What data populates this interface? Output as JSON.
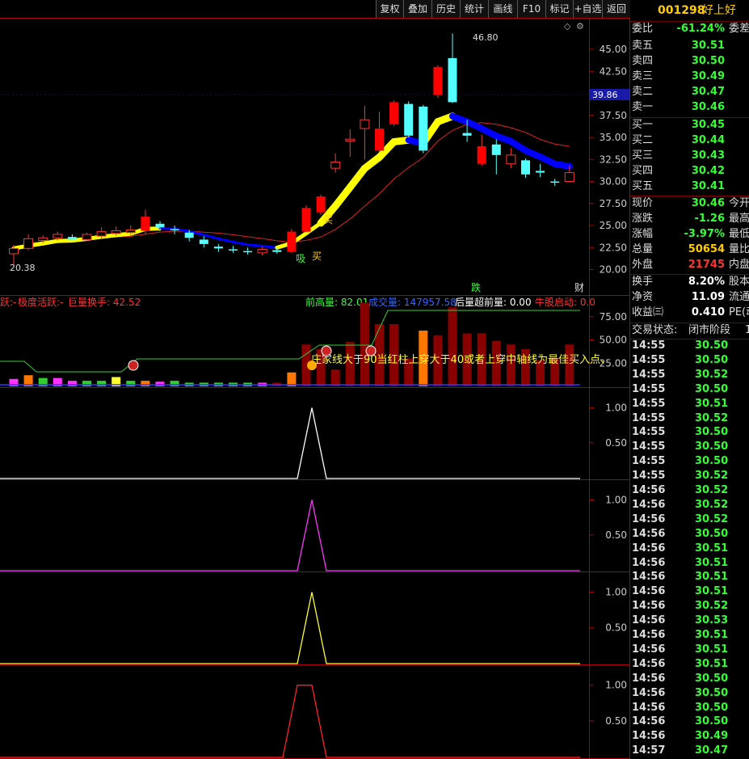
{
  "toolbar": {
    "buttons": [
      "复权",
      "叠加",
      "历史",
      "统计",
      "画线",
      "F10",
      "标记",
      "+自选",
      "返回"
    ]
  },
  "stock": {
    "code": "001298",
    "name": "好上好"
  },
  "quote_ratio": {
    "label": "委比",
    "value": "-61.24%",
    "label2": "委差"
  },
  "asks": [
    {
      "label": "卖五",
      "price": "30.51"
    },
    {
      "label": "卖四",
      "price": "30.50"
    },
    {
      "label": "卖三",
      "price": "30.49"
    },
    {
      "label": "卖二",
      "price": "30.47"
    },
    {
      "label": "卖一",
      "price": "30.46"
    }
  ],
  "bids": [
    {
      "label": "买一",
      "price": "30.45"
    },
    {
      "label": "买二",
      "price": "30.44"
    },
    {
      "label": "买三",
      "price": "30.43"
    },
    {
      "label": "买四",
      "price": "30.42"
    },
    {
      "label": "买五",
      "price": "30.41"
    }
  ],
  "stats1": [
    {
      "label": "现价",
      "value": "30.46",
      "color": "#33ff33",
      "label2": "今开"
    },
    {
      "label": "涨跌",
      "value": "-1.26",
      "color": "#33ff33",
      "label2": "最高"
    },
    {
      "label": "涨幅",
      "value": "-3.97%",
      "color": "#33ff33",
      "label2": "最低"
    },
    {
      "label": "总量",
      "value": "50654",
      "color": "#ffcc00",
      "label2": "量比"
    },
    {
      "label": "外盘",
      "value": "21745",
      "color": "#ff3333",
      "label2": "内盘"
    }
  ],
  "stats2": [
    {
      "label": "换手",
      "value": "8.20%",
      "color": "#ffffff",
      "label2": "股本"
    },
    {
      "label": "净资",
      "value": "11.09",
      "color": "#ffffff",
      "label2": "流通"
    },
    {
      "label": "收益㈢",
      "value": "0.410",
      "color": "#ffffff",
      "label2": "PE(动)"
    }
  ],
  "trade_status": {
    "label": "交易状态:",
    "value": "闭市阶段",
    "extra": "1"
  },
  "ticks": [
    {
      "time": "14:55",
      "price": "30.50"
    },
    {
      "time": "14:55",
      "price": "30.50"
    },
    {
      "time": "14:55",
      "price": "30.52"
    },
    {
      "time": "14:55",
      "price": "30.50"
    },
    {
      "time": "14:55",
      "price": "30.51"
    },
    {
      "time": "14:55",
      "price": "30.52"
    },
    {
      "time": "14:55",
      "price": "30.50"
    },
    {
      "time": "14:55",
      "price": "30.50"
    },
    {
      "time": "14:55",
      "price": "30.50"
    },
    {
      "time": "14:55",
      "price": "30.52"
    },
    {
      "time": "14:56",
      "price": "30.52"
    },
    {
      "time": "14:56",
      "price": "30.52"
    },
    {
      "time": "14:56",
      "price": "30.52"
    },
    {
      "time": "14:56",
      "price": "30.50"
    },
    {
      "time": "14:56",
      "price": "30.51"
    },
    {
      "time": "14:56",
      "price": "30.51"
    },
    {
      "time": "14:56",
      "price": "30.51"
    },
    {
      "time": "14:56",
      "price": "30.51"
    },
    {
      "time": "14:56",
      "price": "30.52"
    },
    {
      "time": "14:56",
      "price": "30.53"
    },
    {
      "time": "14:56",
      "price": "30.51"
    },
    {
      "time": "14:56",
      "price": "30.51"
    },
    {
      "time": "14:56",
      "price": "30.51"
    },
    {
      "time": "14:56",
      "price": "30.50"
    },
    {
      "time": "14:56",
      "price": "30.50"
    },
    {
      "time": "14:56",
      "price": "30.50"
    },
    {
      "time": "14:56",
      "price": "30.50"
    },
    {
      "time": "14:56",
      "price": "30.49"
    },
    {
      "time": "14:57",
      "price": "30.47"
    }
  ],
  "main_chart": {
    "y_ticks": [
      "45.00",
      "42.50",
      "40.00",
      "37.50",
      "35.00",
      "32.50",
      "30.00",
      "27.50",
      "25.00",
      "22.50",
      "20.00"
    ],
    "current_price_tag": "39.86",
    "high_label": "46.80",
    "low_label": "20.38",
    "markers": {
      "buy": "买",
      "buy2": "买",
      "absorb": "吸",
      "fall": "跌",
      "fortune": "财"
    }
  },
  "ind1": {
    "legend": [
      {
        "text": "跃:-",
        "color": "#ff3333"
      },
      {
        "text": "极度活跃:-",
        "color": "#ff3333"
      },
      {
        "text": "巨量换手: 42.52",
        "color": "#ff3333"
      },
      {
        "text": "前高量: 82.01",
        "color": "#33ff33"
      },
      {
        "text": "成交量: 147957.58",
        "color": "#3366ff"
      },
      {
        "text": "后量超前量: 0.00",
        "color": "#ffffff"
      },
      {
        "text": "牛股启动: 0.0",
        "color": "#ff3333"
      }
    ],
    "y_ticks": [
      "75.00",
      "50.00",
      "25.00"
    ],
    "note": "庄家线大于90当红柱上穿大于40或者上穿中轴线为最佳买入点、"
  },
  "sub_panels": [
    {
      "color": "#ffffff",
      "y_ticks": [
        "1.00",
        "0.50"
      ]
    },
    {
      "color": "#ff33ff",
      "y_ticks": [
        "1.00",
        "0.50"
      ]
    },
    {
      "color": "#ffff33",
      "y_ticks": [
        "1.00",
        "0.50"
      ]
    },
    {
      "color": "#ff2222",
      "y_ticks": [
        "1.00",
        "0.50"
      ]
    }
  ],
  "candles": [
    {
      "o": 21.8,
      "c": 22.4,
      "h": 22.8,
      "l": 20.4
    },
    {
      "o": 22.4,
      "c": 23.5,
      "h": 24.0,
      "l": 22.2
    },
    {
      "o": 23.3,
      "c": 23.6,
      "h": 23.9,
      "l": 23.0
    },
    {
      "o": 23.6,
      "c": 24.0,
      "h": 24.3,
      "l": 23.3
    },
    {
      "o": 23.7,
      "c": 23.4,
      "h": 24.0,
      "l": 23.2
    },
    {
      "o": 23.4,
      "c": 24.0,
      "h": 24.2,
      "l": 23.2
    },
    {
      "o": 23.8,
      "c": 24.3,
      "h": 24.8,
      "l": 23.5
    },
    {
      "o": 24.1,
      "c": 24.4,
      "h": 24.9,
      "l": 23.8
    },
    {
      "o": 24.2,
      "c": 24.5,
      "h": 25.0,
      "l": 23.9
    },
    {
      "o": 24.4,
      "c": 26.0,
      "h": 26.8,
      "l": 24.0
    },
    {
      "o": 25.2,
      "c": 24.8,
      "h": 25.5,
      "l": 24.4
    },
    {
      "o": 24.6,
      "c": 24.5,
      "h": 25.0,
      "l": 24.0
    },
    {
      "o": 24.2,
      "c": 23.6,
      "h": 24.5,
      "l": 23.2
    },
    {
      "o": 23.4,
      "c": 22.9,
      "h": 23.8,
      "l": 22.5
    },
    {
      "o": 22.6,
      "c": 22.4,
      "h": 22.9,
      "l": 22.0
    },
    {
      "o": 22.3,
      "c": 22.2,
      "h": 22.7,
      "l": 21.9
    },
    {
      "o": 22.1,
      "c": 22.0,
      "h": 22.5,
      "l": 21.7
    },
    {
      "o": 21.9,
      "c": 22.3,
      "h": 22.6,
      "l": 21.6
    },
    {
      "o": 22.2,
      "c": 22.0,
      "h": 22.5,
      "l": 21.8
    },
    {
      "o": 22.0,
      "c": 24.3,
      "h": 24.6,
      "l": 21.9
    },
    {
      "o": 24.3,
      "c": 27.0,
      "h": 27.3,
      "l": 24.2
    },
    {
      "o": 26.5,
      "c": 28.3,
      "h": 28.5,
      "l": 26.2
    },
    {
      "o": 31.5,
      "c": 32.2,
      "h": 33.2,
      "l": 31.0
    },
    {
      "o": 34.6,
      "c": 34.8,
      "h": 35.9,
      "l": 32.8
    },
    {
      "o": 36.0,
      "c": 37.0,
      "h": 38.6,
      "l": 32.5
    },
    {
      "o": 33.5,
      "c": 36.0,
      "h": 37.9,
      "l": 33.3
    },
    {
      "o": 36.5,
      "c": 39.0,
      "h": 39.2,
      "l": 36.3
    },
    {
      "o": 38.8,
      "c": 35.2,
      "h": 39.1,
      "l": 35.0
    },
    {
      "o": 38.5,
      "c": 33.5,
      "h": 38.7,
      "l": 33.2
    },
    {
      "o": 39.8,
      "c": 43.0,
      "h": 43.2,
      "l": 39.5
    },
    {
      "o": 44.0,
      "c": 39.0,
      "h": 46.8,
      "l": 38.9
    },
    {
      "o": 35.5,
      "c": 35.2,
      "h": 37.0,
      "l": 34.5
    },
    {
      "o": 32.0,
      "c": 34.0,
      "h": 35.3,
      "l": 31.8
    },
    {
      "o": 34.2,
      "c": 33.0,
      "h": 34.8,
      "l": 30.8
    },
    {
      "o": 32.0,
      "c": 33.0,
      "h": 33.8,
      "l": 31.5
    },
    {
      "o": 32.4,
      "c": 30.8,
      "h": 32.6,
      "l": 30.4
    },
    {
      "o": 31.2,
      "c": 31.0,
      "h": 32.0,
      "l": 30.5
    },
    {
      "o": 30.0,
      "c": 29.9,
      "h": 30.3,
      "l": 29.5
    },
    {
      "o": 30.0,
      "c": 31.0,
      "h": 31.8,
      "l": 29.9
    }
  ]
}
